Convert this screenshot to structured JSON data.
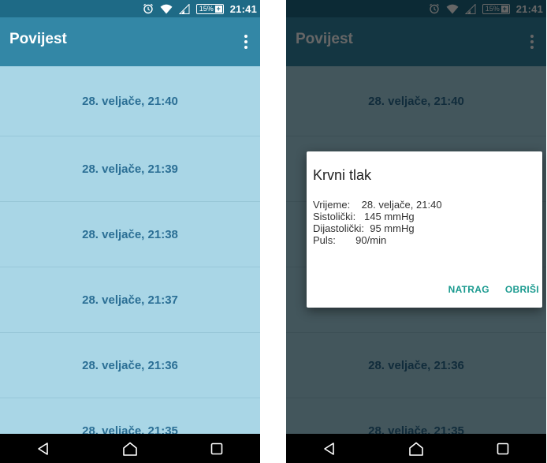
{
  "status_bar": {
    "battery": "15%",
    "time": "21:41",
    "icons": [
      "alarm-icon",
      "wifi-icon",
      "signal-icon",
      "battery-charging-icon"
    ]
  },
  "app_bar": {
    "title": "Povijest",
    "menu_icon": "overflow-menu-icon"
  },
  "history": {
    "items": [
      "28. veljače, 21:40",
      "28. veljače, 21:39",
      "28. veljače, 21:38",
      "28. veljače, 21:37",
      "28. veljače, 21:36",
      "28. veljače, 21:35"
    ]
  },
  "dialog": {
    "title": "Krvni tlak",
    "rows": [
      "Vrijeme:    28. veljače, 21:40",
      "Sistolički:   145 mmHg",
      "Dijastolički:  95 mmHg",
      "Puls:       90/min"
    ],
    "back_label": "NATRAG",
    "delete_label": "OBRIŠI"
  },
  "nav_bar": {
    "icons": [
      "back-icon",
      "home-icon",
      "recents-icon"
    ]
  },
  "colors": {
    "status_bar": "#1e6a86",
    "app_bar": "#3387a6",
    "list_background": "#a9d6e6",
    "list_text": "#2b6f95",
    "dialog_accent": "#1a9a8f"
  }
}
